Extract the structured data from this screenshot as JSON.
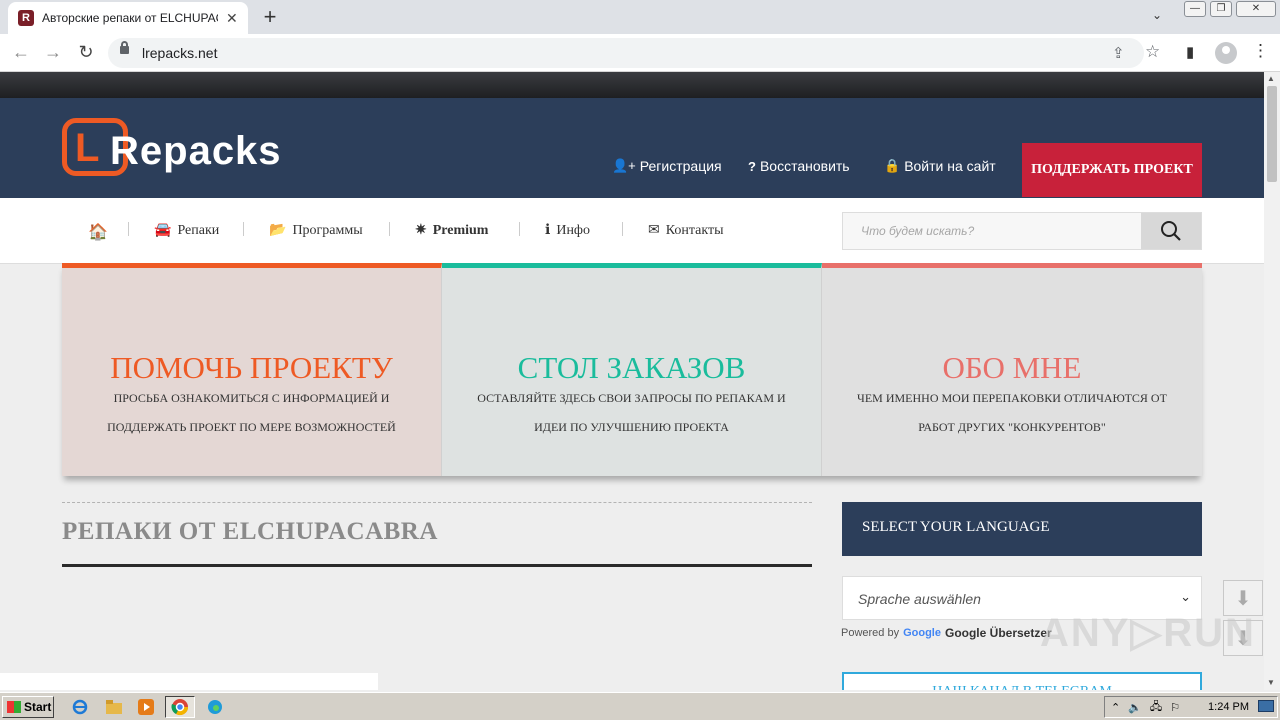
{
  "browser": {
    "tab_title": "Авторские репаки от ELCHUPACABRA",
    "tab_favicon": "R",
    "tab_close": "✕",
    "new_tab": "+",
    "tab_search": "⌄",
    "url": "lrepacks.net",
    "back_icon": "←",
    "forward_icon": "→",
    "reload_icon": "↻",
    "share_icon": "⇪",
    "star_icon": "☆",
    "sidepanel_icon": "▮",
    "menu_icon": "⋮",
    "win_minimize": "—",
    "win_restore": "❐",
    "win_close": "✕"
  },
  "site": {
    "logo_mark": "L",
    "logo_text": "Repacks",
    "header_links": [
      {
        "icon": "👤+",
        "label": "Регистрация"
      },
      {
        "icon": "?",
        "label": "Восстановить"
      },
      {
        "icon": "🔒",
        "label": "Войти на сайт"
      }
    ],
    "support_button": "ПОДДЕРЖАТЬ ПРОЕКТ",
    "nav": [
      {
        "icon": "🏠",
        "label": ""
      },
      {
        "icon": "🚘",
        "label": "Репаки"
      },
      {
        "icon": "📂",
        "label": "Программы"
      },
      {
        "icon": "✷",
        "label": "Premium"
      },
      {
        "icon": "ℹ",
        "label": "Инфо"
      },
      {
        "icon": "✉",
        "label": "Контакты"
      }
    ],
    "search_placeholder": "Что будем искать?",
    "boxes": [
      {
        "title": "ПОМОЧЬ ПРОЕКТУ",
        "text": "ПРОСЬБА ОЗНАКОМИТЬСЯ С ИНФОРМАЦИЕЙ И ПОДДЕРЖАТЬ ПРОЕКТ ПО МЕРЕ ВОЗМОЖНОСТЕЙ",
        "accent": "#ee5a24",
        "bg": "#e4d7d4"
      },
      {
        "title": "СТОЛ ЗАКАЗОВ",
        "text": "ОСТАВЛЯЙТЕ ЗДЕСЬ СВОИ ЗАПРОСЫ ПО РЕПАКАМ И ИДЕИ ПО УЛУЧШЕНИЮ ПРОЕКТА",
        "accent": "#1abc9c",
        "bg": "#dee2e1"
      },
      {
        "title": "ОБО МНЕ",
        "text": "ЧЕМ ИМЕННО МОИ ПЕРЕПАКОВКИ ОТЛИЧАЮТСЯ ОТ РАБОТ ДРУГИХ \"КОНКУРЕНТОВ\"",
        "accent": "#e8706a",
        "bg": "#e0e0e0"
      }
    ],
    "section_title": "РЕПАКИ ОТ ELCHUPACABRA",
    "lang_box_title": "SELECT YOUR LANGUAGE",
    "lang_select_value": "Sprache auswählen",
    "powered_by": "Powered by",
    "google_word": "Google",
    "translator": "Google Übersetzer",
    "telegram_label": "НАШ КАНАЛ В TELEGRAM",
    "watermark": "ANY▷RUN"
  },
  "taskbar": {
    "start_label": "Start",
    "clock": "1:24 PM"
  },
  "colors": {
    "header_bg": "#2c3e5a",
    "support_btn": "#c8213a",
    "logo_orange": "#ee5a24"
  }
}
